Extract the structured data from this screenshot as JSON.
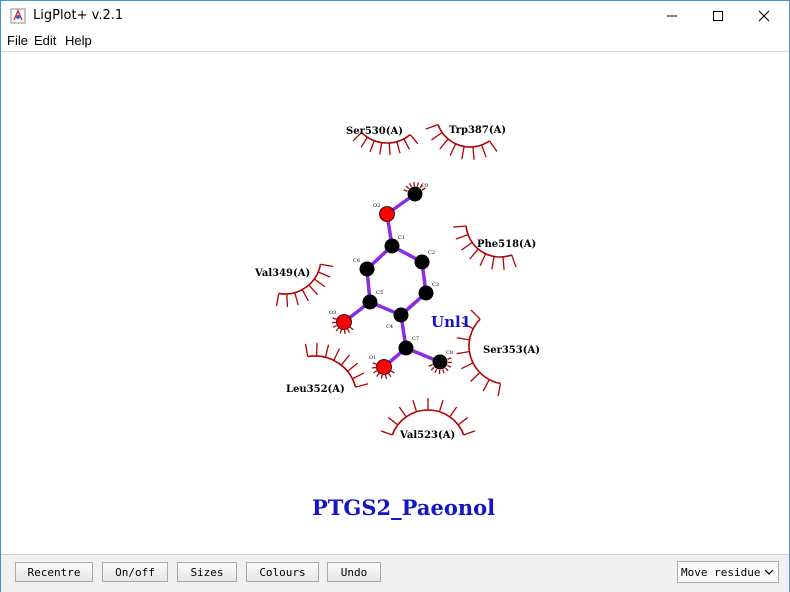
{
  "window": {
    "title": "LigPlot+ v.2.1"
  },
  "menu": {
    "file": "File",
    "edit": "Edit",
    "help": "Help"
  },
  "plot": {
    "title": "PTGS2_Paeonol",
    "ligand_name": "Unl1",
    "atoms": {
      "o1": "O1",
      "o2": "O2",
      "o3": "O3",
      "c1": "C1",
      "c2": "C2",
      "c3": "C3",
      "c4": "C4",
      "c5": "C5",
      "c6": "C6",
      "c7": "C7",
      "c8": "C8",
      "c9": "C9"
    },
    "residues": {
      "ser530": "Ser530(A)",
      "trp387": "Trp387(A)",
      "phe518": "Phe518(A)",
      "val349": "Val349(A)",
      "ser353": "Ser353(A)",
      "leu352": "Leu352(A)",
      "val523": "Val523(A)"
    },
    "colors": {
      "bond": "#8b2be2",
      "carbon": "#000000",
      "oxygen": "#ff0000",
      "hydrophobic": "#b30000",
      "title": "#1515c8"
    }
  },
  "toolbar": {
    "recentre": "Recentre",
    "onoff": "On/off",
    "sizes": "Sizes",
    "colours": "Colours",
    "undo": "Undo",
    "mode": "Move residue"
  }
}
